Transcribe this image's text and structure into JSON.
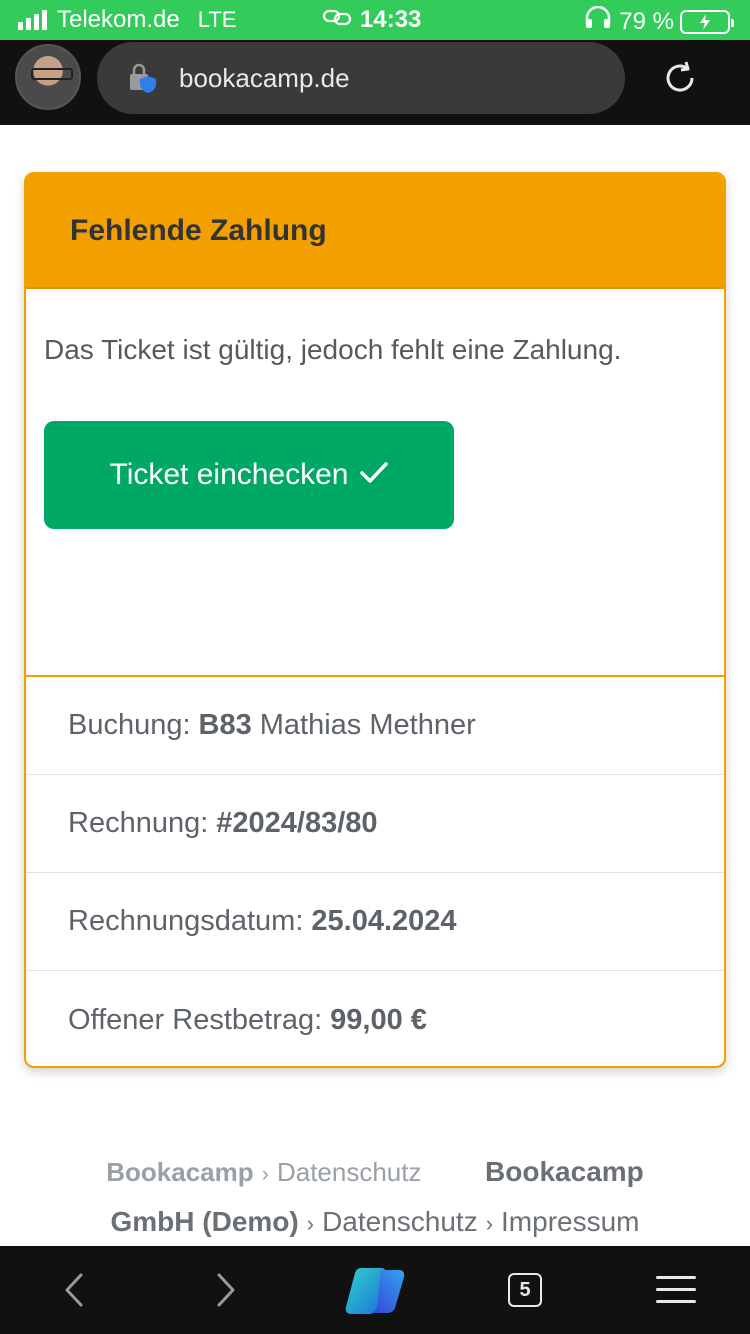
{
  "statusbar": {
    "carrier": "Telekom.de",
    "network": "LTE",
    "time": "14:33",
    "battery_percent": "79 %",
    "icons": [
      "signal-icon",
      "link-icon",
      "headphones-icon",
      "battery-charging-icon"
    ]
  },
  "browser": {
    "url": "bookacamp.de",
    "icons": [
      "avatar",
      "lock-shield-icon",
      "reload-icon"
    ]
  },
  "card": {
    "header_title": "Fehlende Zahlung",
    "message": "Das Ticket ist gültig, jedoch fehlt eine Zahlung.",
    "checkin_button": "Ticket einchecken",
    "rows": [
      {
        "label": "Buchung:",
        "bold": "B83",
        "rest": "Mathias Methner"
      },
      {
        "label": "Rechnung:",
        "bold": "#2024/83/80",
        "rest": ""
      },
      {
        "label": "Rechnungsdatum:",
        "bold": "25.04.2024",
        "rest": ""
      },
      {
        "label": "Offener Restbetrag:",
        "bold": "99,00 €",
        "rest": ""
      }
    ],
    "colors": {
      "header": "#f2a000",
      "button": "#00a865"
    }
  },
  "footer": {
    "links": [
      {
        "label": "Bookacamp"
      },
      {
        "label": "Datenschutz"
      },
      {
        "label": "Bookacamp GmbH (Demo)"
      },
      {
        "label": "Datenschutz"
      },
      {
        "label": "Impressum"
      }
    ],
    "line1_part1": "Bookacamp",
    "line1_part2": "Datenschutz",
    "line1_part3": "Bookacamp",
    "line2_part1": "GmbH (Demo)",
    "line2_part2": "Datenschutz",
    "line2_part3": "Impressum"
  },
  "toolbar": {
    "tab_count": "5",
    "icons": [
      "back-icon",
      "forward-icon",
      "copilot-icon",
      "tabs-icon",
      "menu-icon"
    ]
  }
}
